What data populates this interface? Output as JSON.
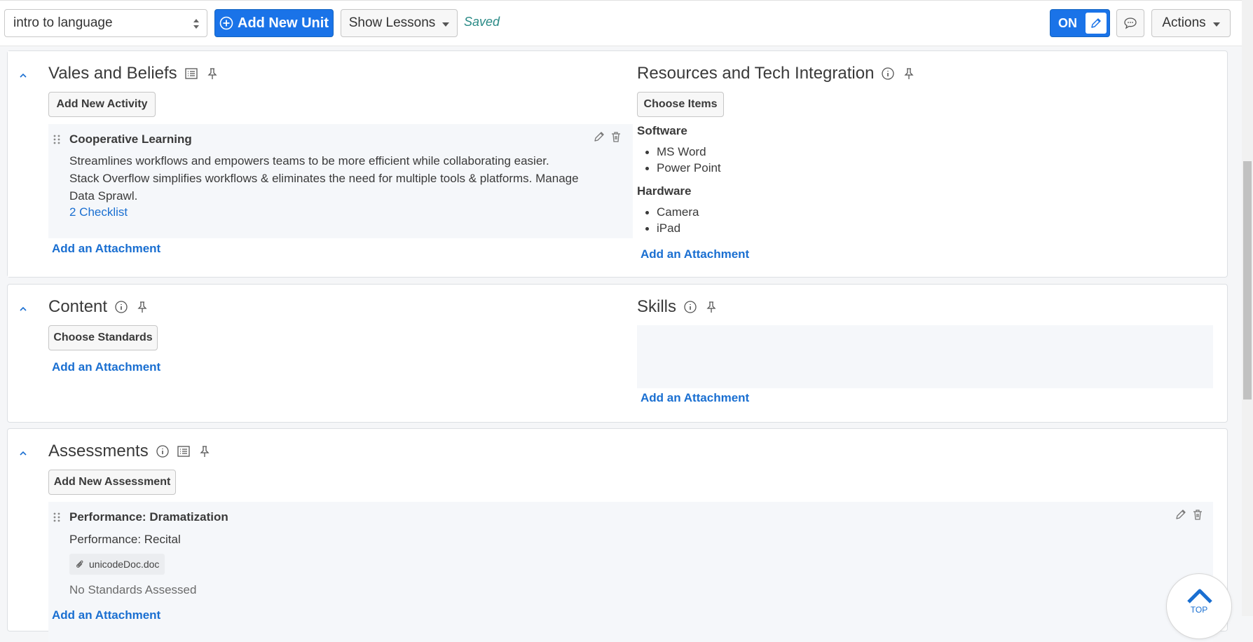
{
  "toolbar": {
    "unit_select_value": "intro to language",
    "add_unit_label": "Add New Unit",
    "show_lessons_label": "Show Lessons",
    "saved_label": "Saved",
    "edit_toggle_label": "ON",
    "actions_label": "Actions"
  },
  "sections": {
    "values": {
      "title": "Vales and Beliefs",
      "add_button": "Add New Activity",
      "activity": {
        "title": "Cooperative Learning",
        "description": "Streamlines workflows and empowers teams to be more efficient while collaborating easier. Stack Overflow simplifies workflows & eliminates the need for multiple tools & platforms. Manage Data Sprawl.",
        "checklist_link": "2 Checklist"
      },
      "attachment_link": "Add an Attachment"
    },
    "resources": {
      "title": "Resources and Tech Integration",
      "choose_button": "Choose Items",
      "software_heading": "Software",
      "software_items": [
        "MS Word",
        "Power Point"
      ],
      "hardware_heading": "Hardware",
      "hardware_items": [
        "Camera",
        "iPad"
      ],
      "attachment_link": "Add an Attachment"
    },
    "content": {
      "title": "Content",
      "choose_button": "Choose Standards",
      "attachment_link": "Add an Attachment"
    },
    "skills": {
      "title": "Skills",
      "attachment_link": "Add an Attachment"
    },
    "assessments": {
      "title": "Assessments",
      "add_button": "Add New Assessment",
      "item": {
        "title": "Performance: Dramatization",
        "subtitle": "Performance: Recital",
        "file_name": "unicodeDoc.doc",
        "standards_text": "No Standards Assessed"
      },
      "attachment_link": "Add an Attachment"
    }
  },
  "top_button_label": "TOP",
  "colors": {
    "primary": "#1a73e8",
    "link": "#1a6fd1",
    "saved": "#2a8a86"
  },
  "icons": [
    "sort-arrows-icon",
    "plus-circle-icon",
    "chevron-down-icon",
    "pencil-icon",
    "comment-icon",
    "chevron-up-icon",
    "list-icon",
    "pin-icon",
    "info-icon",
    "drag-grip-icon",
    "trash-icon",
    "paperclip-icon"
  ]
}
